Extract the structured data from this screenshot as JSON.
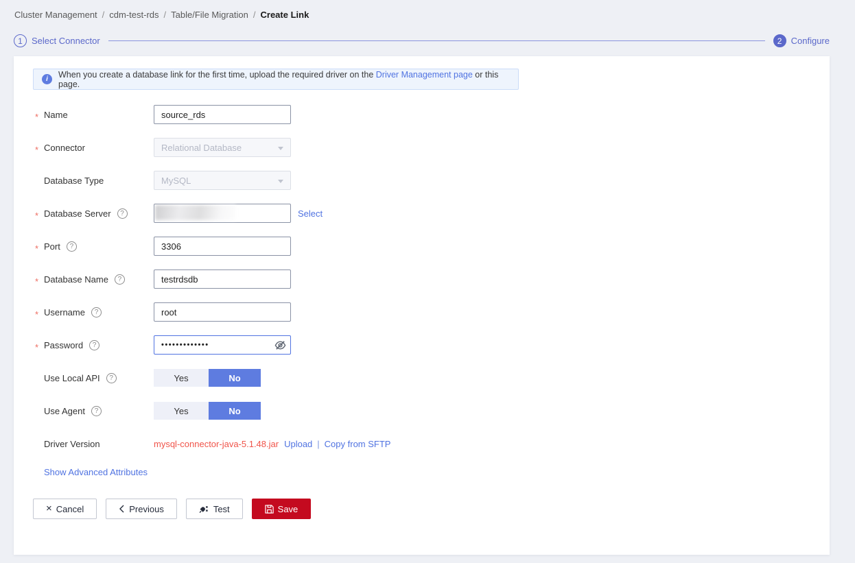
{
  "breadcrumb": {
    "items": [
      "Cluster Management",
      "cdm-test-rds",
      "Table/File Migration"
    ],
    "separator": "/",
    "current": "Create Link"
  },
  "steps": {
    "step1": {
      "number": "1",
      "label": "Select Connector"
    },
    "step2": {
      "number": "2",
      "label": "Configure"
    }
  },
  "banner": {
    "text_before": "When you create a database link for the first time, upload the required driver on the ",
    "link_text": "Driver Management page",
    "text_after": " or this page."
  },
  "icons": {
    "info": "i",
    "help": "?",
    "close": "×"
  },
  "required_marker": "*",
  "form": {
    "name": {
      "label": "Name",
      "value": "source_rds"
    },
    "connector": {
      "label": "Connector",
      "value": "Relational Database"
    },
    "database_type": {
      "label": "Database Type",
      "value": "MySQL"
    },
    "database_server": {
      "label": "Database Server",
      "value": "",
      "action_link": "Select"
    },
    "port": {
      "label": "Port",
      "value": "3306"
    },
    "database_name": {
      "label": "Database Name",
      "value": "testrdsdb"
    },
    "username": {
      "label": "Username",
      "value": "root"
    },
    "password": {
      "label": "Password",
      "value": "•••••••••••••"
    },
    "use_local_api": {
      "label": "Use Local API",
      "option_yes": "Yes",
      "option_no": "No",
      "selected": "No"
    },
    "use_agent": {
      "label": "Use Agent",
      "option_yes": "Yes",
      "option_no": "No",
      "selected": "No"
    },
    "driver_version": {
      "label": "Driver Version",
      "file": "mysql-connector-java-5.1.48.jar",
      "upload_link": "Upload",
      "separator": "|",
      "copy_link": "Copy from SFTP"
    },
    "advanced_link": "Show Advanced Attributes"
  },
  "footer": {
    "cancel": "Cancel",
    "previous": "Previous",
    "test": "Test",
    "save": "Save"
  },
  "colors": {
    "accent_link": "#5073e1",
    "toggle_on": "#5e7ce0",
    "step": "#5b68ca",
    "save_button": "#c40a1f",
    "driver_file_text": "#f0544a",
    "page_background": "#eef0f5"
  }
}
